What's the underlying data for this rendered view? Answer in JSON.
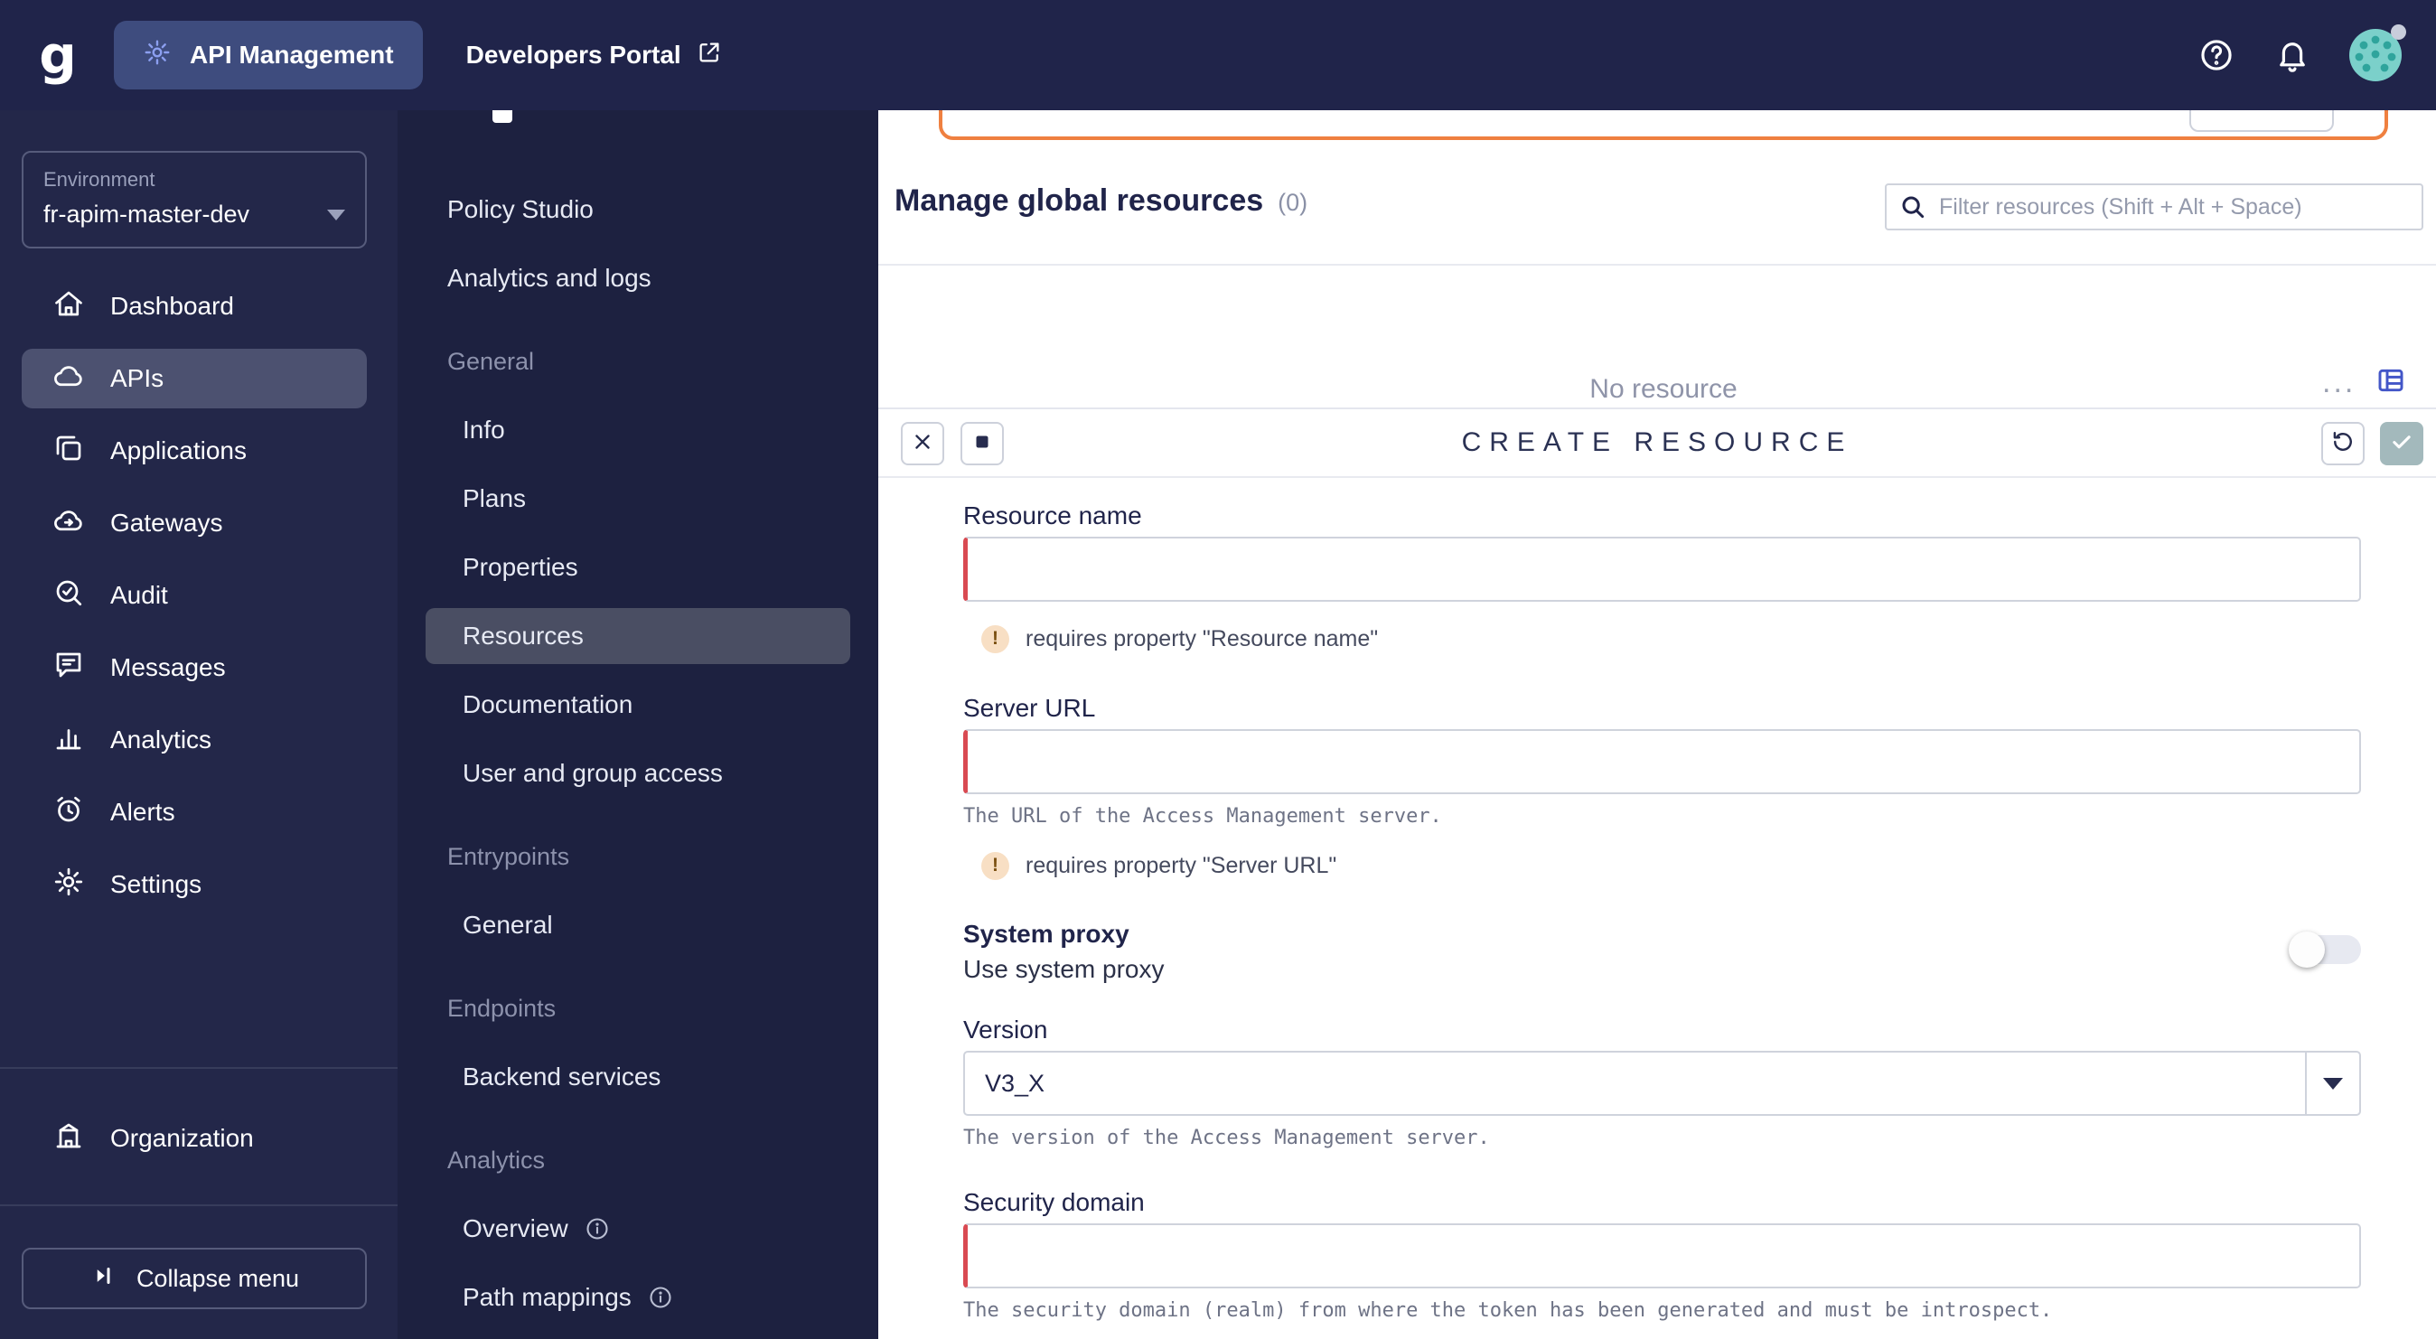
{
  "topbar": {
    "logo": "g",
    "api_management_label": "API Management",
    "developers_portal_label": "Developers Portal"
  },
  "sidebar": {
    "environment": {
      "label": "Environment",
      "value": "fr-apim-master-dev"
    },
    "items": [
      {
        "label": "Dashboard"
      },
      {
        "label": "APIs"
      },
      {
        "label": "Applications"
      },
      {
        "label": "Gateways"
      },
      {
        "label": "Audit"
      },
      {
        "label": "Messages"
      },
      {
        "label": "Analytics"
      },
      {
        "label": "Alerts"
      },
      {
        "label": "Settings"
      }
    ],
    "organization_label": "Organization",
    "collapse_label": "Collapse menu"
  },
  "submenu": {
    "items": [
      {
        "label": "Policy Studio"
      },
      {
        "label": "Analytics and logs"
      },
      {
        "label": "General"
      },
      {
        "label": "Info"
      },
      {
        "label": "Plans"
      },
      {
        "label": "Properties"
      },
      {
        "label": "Resources"
      },
      {
        "label": "Documentation"
      },
      {
        "label": "User and group access"
      },
      {
        "label": "Entrypoints"
      },
      {
        "label": "General"
      },
      {
        "label": "Endpoints"
      },
      {
        "label": "Backend services"
      },
      {
        "label": "Analytics"
      },
      {
        "label": "Overview"
      },
      {
        "label": "Path mappings"
      }
    ]
  },
  "main": {
    "title": "Manage global resources",
    "count": "(0)",
    "filter_placeholder": "Filter resources (Shift + Alt + Space)",
    "empty_text": "No resource",
    "more_label": "..."
  },
  "dialog": {
    "title": "CREATE RESOURCE",
    "error_badge": "!",
    "resource_name": {
      "label": "Resource name",
      "error": "requires property \"Resource name\""
    },
    "server_url": {
      "label": "Server URL",
      "help": "The URL of the Access Management server.",
      "error": "requires property \"Server URL\""
    },
    "system_proxy": {
      "label": "System proxy",
      "description": "Use system proxy"
    },
    "version": {
      "label": "Version",
      "value": "V3_X",
      "help": "The version of the Access Management server."
    },
    "security_domain": {
      "label": "Security domain",
      "help": "The security domain (realm) from where the token has been generated and must be introspect."
    }
  },
  "colors": {
    "topbar_bg": "#20244a",
    "error_red": "#d94a52",
    "warning_orange": "#ef8040",
    "confirm_teal": "#a3b9bc"
  }
}
